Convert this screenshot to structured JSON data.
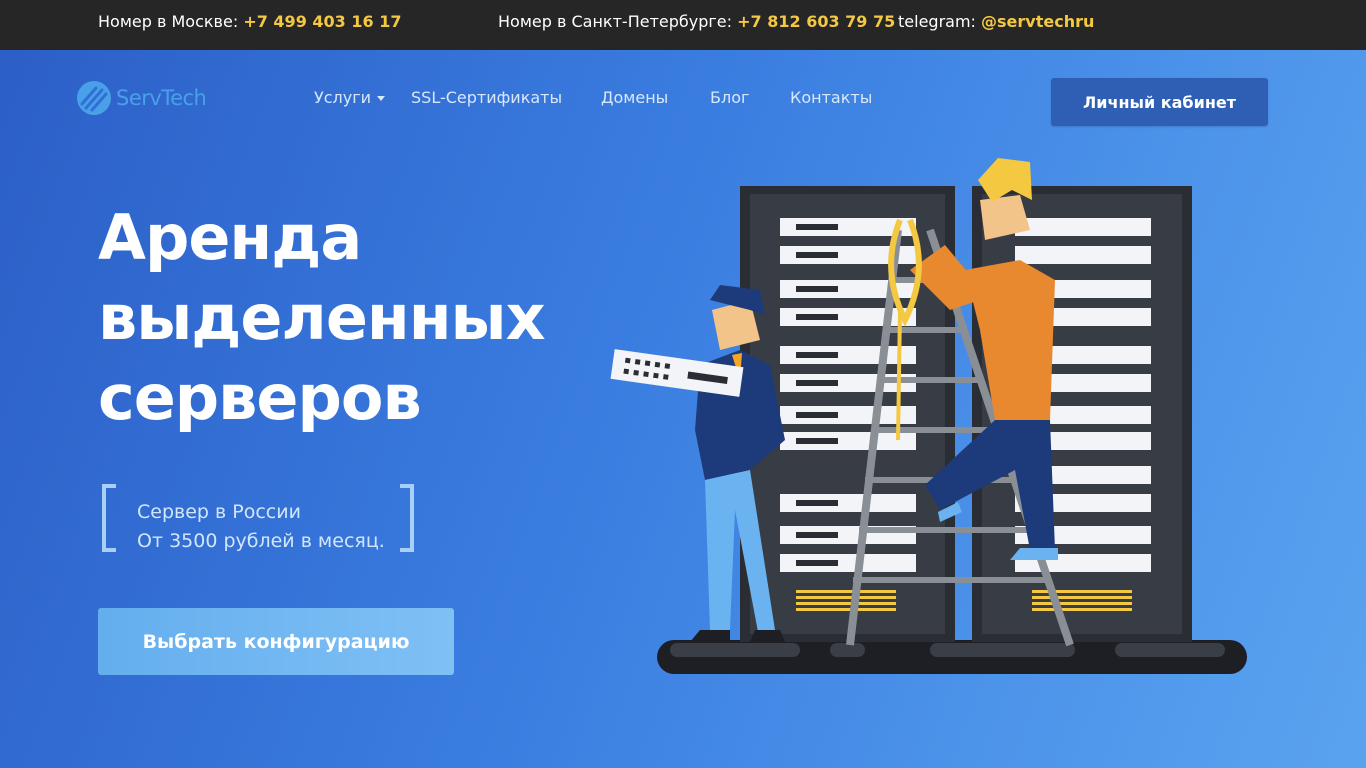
{
  "topbar": {
    "moscow_label": "Номер в Москве:",
    "moscow_phone": "+7 499 403 16 17",
    "spb_label": "Номер в Санкт-Петербурге:",
    "spb_phone": "+7 812 603 79 75",
    "telegram_label": "telegram:",
    "telegram_handle": "@servtechru"
  },
  "header": {
    "logo_text": "ServTech",
    "nav": [
      {
        "label": "Услуги",
        "has_dropdown": true
      },
      {
        "label": "SSL-Сертификаты"
      },
      {
        "label": "Домены"
      },
      {
        "label": "Блог"
      },
      {
        "label": "Контакты"
      }
    ],
    "cabinet_label": "Личный кабинет"
  },
  "hero": {
    "title_lines": [
      "Аренда",
      "выделенных",
      "серверов"
    ],
    "info_lines": [
      "Сервер в России",
      "От 3500 рублей в месяц."
    ],
    "cta_label": "Выбрать конфигурацию"
  },
  "colors": {
    "accent_yellow": "#f5c842",
    "topbar_bg": "#262626",
    "hero_gradient_start": "#2c5fc7",
    "hero_gradient_end": "#5aa3ef",
    "cabinet_button": "#2e5fb5",
    "cta_button": "#6ab3f0"
  },
  "icons": {
    "logo": "servtech-logo-icon",
    "nav_dropdown": "chevron-down-icon"
  }
}
